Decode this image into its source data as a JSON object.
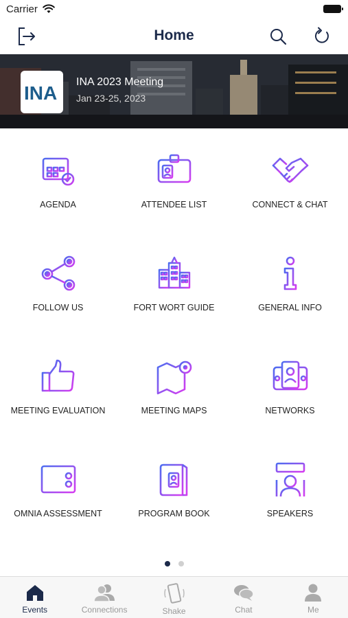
{
  "status_bar": {
    "carrier": "Carrier"
  },
  "navbar": {
    "title": "Home"
  },
  "banner": {
    "logo_text": "INA",
    "event_title": "INA 2023 Meeting",
    "event_dates": "Jan 23-25, 2023"
  },
  "grid": {
    "tiles": [
      {
        "label": "AGENDA",
        "icon": "calendar-icon"
      },
      {
        "label": "ATTENDEE LIST",
        "icon": "id-badge-icon"
      },
      {
        "label": "CONNECT & CHAT",
        "icon": "handshake-icon"
      },
      {
        "label": "FOLLOW US",
        "icon": "share-icon"
      },
      {
        "label": "FORT WORT GUIDE",
        "icon": "city-icon"
      },
      {
        "label": "GENERAL INFO",
        "icon": "info-icon"
      },
      {
        "label": "MEETING EVALUATION",
        "icon": "thumbs-up-icon"
      },
      {
        "label": "MEETING MAPS",
        "icon": "map-icon"
      },
      {
        "label": "NETWORKS",
        "icon": "network-icon"
      },
      {
        "label": "OMNIA ASSESSMENT",
        "icon": "checklist-icon"
      },
      {
        "label": "PROGRAM BOOK",
        "icon": "book-icon"
      },
      {
        "label": "SPEAKERS",
        "icon": "speaker-icon"
      }
    ]
  },
  "pager": {
    "pages": 2,
    "current": 1
  },
  "tabbar": {
    "tabs": [
      {
        "label": "Events",
        "icon": "home-icon",
        "active": true
      },
      {
        "label": "Connections",
        "icon": "people-icon",
        "active": false
      },
      {
        "label": "Shake",
        "icon": "shake-phone-icon",
        "active": false
      },
      {
        "label": "Chat",
        "icon": "chat-bubble-icon",
        "active": false
      },
      {
        "label": "Me",
        "icon": "person-icon",
        "active": false
      }
    ]
  },
  "colors": {
    "accent": "#1c2a4a",
    "icon_gradient_start": "#4d6cf0",
    "icon_gradient_end": "#d63cf0",
    "inactive_tab": "#999999"
  }
}
